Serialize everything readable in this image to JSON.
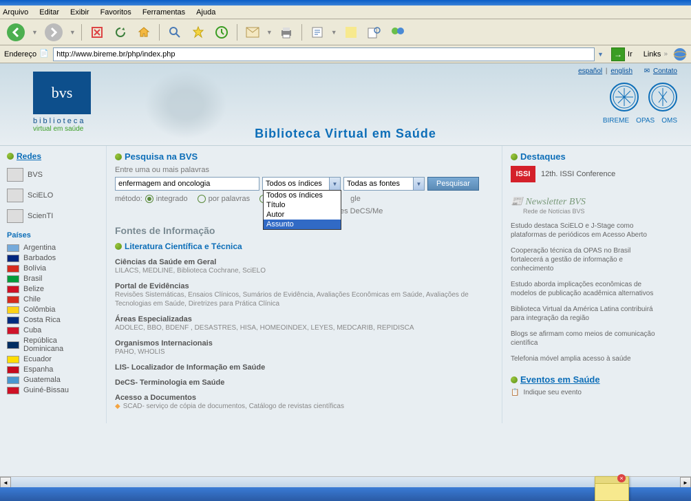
{
  "menubar": [
    "Arquivo",
    "Editar",
    "Exibir",
    "Favoritos",
    "Ferramentas",
    "Ajuda"
  ],
  "address": {
    "label": "Endereço",
    "url": "http://www.bireme.br/php/index.php",
    "go": "Ir",
    "links": "Links"
  },
  "header": {
    "lang_es": "español",
    "lang_en": "english",
    "contact": "Contato",
    "logo": "bvs",
    "logo_line1": "biblioteca",
    "logo_line2": "virtual em saúde",
    "title": "Biblioteca Virtual em Saúde",
    "org1": "BIREME",
    "org2": "OPAS",
    "org3": "OMS"
  },
  "sidebar": {
    "redes_title": "Redes",
    "nets": [
      "BVS",
      "SciELO",
      "ScienTI"
    ],
    "countries_title": "Países",
    "countries": [
      "Argentina",
      "Barbados",
      "Bolívia",
      "Brasil",
      "Belize",
      "Chile",
      "Colômbia",
      "Costa Rica",
      "Cuba",
      "República Dominicana",
      "Ecuador",
      "Espanha",
      "Guatemala",
      "Guiné-Bissau"
    ],
    "flag_colors": [
      "#75aadb",
      "#00267f",
      "#d52b1e",
      "#009c3b",
      "#ce1126",
      "#d52b1e",
      "#fcd116",
      "#002b7f",
      "#cf142b",
      "#002d62",
      "#ffdd00",
      "#c60b1e",
      "#4997d0",
      "#ce1126"
    ]
  },
  "search": {
    "title": "Pesquisa na BVS",
    "label1": "Entre uma ou mais palavras",
    "input": "enfermagem and oncologia",
    "sel1": "Todos os índices",
    "sel1_opts": [
      "Todos os índices",
      "Título",
      "Autor",
      "Assunto"
    ],
    "sel1_selected_index": 3,
    "sel2": "Todas as fontes",
    "btn": "Pesquisar",
    "method_label": "método:",
    "m1": "integrado",
    "m2": "por palavras",
    "m3_frag": "gle",
    "descrit": "pesquisa via descritores DeCS/Me"
  },
  "fonts": {
    "title": "Fontes de Informação",
    "lit_title": "Literatura Científica e Técnica",
    "items": [
      {
        "h": "Ciências da Saúde em Geral",
        "d": "LILACS, MEDLINE, Biblioteca Cochrane, SciELO"
      },
      {
        "h": "Portal de Evidências",
        "d": "Revisões Sistemáticas, Ensaios Clínicos, Sumários de Evidência, Avaliações Econômicas em Saúde, Avaliações de Tecnologias em Saúde, Diretrizes para Prática Clínica"
      },
      {
        "h": "Áreas Especializadas",
        "d": "ADOLEC, BBO, BDENF , DESASTRES, HISA, HOMEOINDEX, LEYES, MEDCARIB, REPIDISCA"
      },
      {
        "h": "Organismos Internacionais",
        "d": "PAHO, WHOLIS"
      },
      {
        "h": "LIS- Localizador de Informação em Saúde",
        "d": ""
      },
      {
        "h": "DeCS- Terminologia em Saúde",
        "d": ""
      },
      {
        "h": "Acesso a Documentos",
        "d": "SCAD- serviço de cópia de documentos, Catálogo de revistas científicas"
      }
    ]
  },
  "right": {
    "dest_title": "Destaques",
    "issi": "ISSI",
    "issi_text": "12th. ISSI Conference",
    "news_title": "Newsletter BVS",
    "news_sub": "Rede de Notícias BVS",
    "news": [
      "Estudo destaca SciELO e J-Stage como plataformas de periódicos em Acesso Aberto",
      "Cooperação técnica da OPAS no Brasil fortalecerá a gestão de informação e conhecimento",
      "Estudo aborda implicações econômicas de modelos de publicação acadêmica alternativos",
      "Biblioteca Virtual da América Latina contribuirá para integração da região",
      "Blogs se afirmam como meios de comunicação científica",
      "Telefonia móvel amplia acesso à saúde"
    ],
    "ev_title": "Eventos em Saúde",
    "ev_item": "Indique seu evento"
  }
}
